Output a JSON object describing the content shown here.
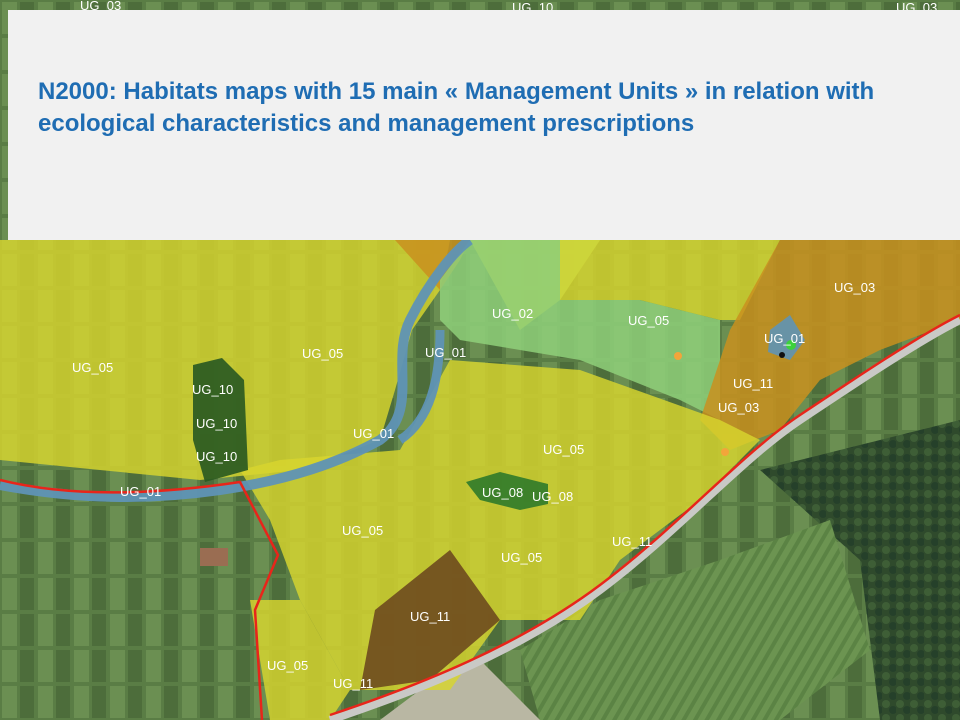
{
  "title": "N2000: Habitats maps with  15 main « Management Units » in relation with ecological characteristics and management prescriptions",
  "colors": {
    "unit_yellow": "#d8d62e",
    "unit_orange": "#c9911f",
    "unit_green_light": "#8fd07a",
    "unit_dark_green": "#2a5a22",
    "unit_brown": "#6e4a1e",
    "river": "#5f93b5",
    "boundary": "#e8251a",
    "title_text": "#1f6db3",
    "title_bg": "#f1f1f1"
  },
  "labels": {
    "ug03_top_left": "UG_03",
    "ug10_top": "UG_10",
    "ug03_top_right": "UG_03",
    "ug03_right": "UG_03",
    "ug02": "UG_02",
    "ug05_upper_right": "UG_05",
    "ug01_pond": "UG_01",
    "ug05_left": "UG_05",
    "ug05_center_top": "UG_05",
    "ug01_river_mid": "UG_01",
    "ug10_a": "UG_10",
    "ug10_b": "UG_10",
    "ug10_c": "UG_10",
    "ug11_upper": "UG_11",
    "ug03_lower_right": "UG_03",
    "ug01_river_lower": "UG_01",
    "ug05_center": "UG_05",
    "ug01_river_left": "UG_01",
    "ug08_a": "UG_08",
    "ug08_b": "UG_08",
    "ug05_lower": "UG_05",
    "ug11_road": "UG_11",
    "ug05_bottom": "UG_05",
    "ug11_brown": "UG_11",
    "ug05_bottom_left": "UG_05",
    "ug11_bottom": "UG_11"
  }
}
